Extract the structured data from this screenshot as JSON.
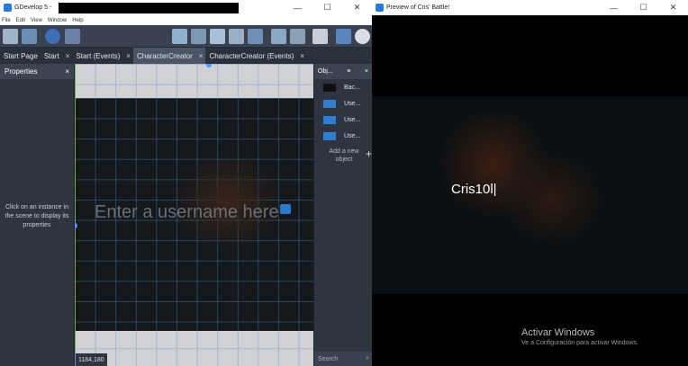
{
  "gdevelop": {
    "title": "GDevelop 5 -",
    "menu": [
      "File",
      "Edit",
      "View",
      "Window",
      "Help"
    ],
    "win_controls": {
      "minimize": "—",
      "maximize": "☐",
      "close": "✕"
    },
    "tabs": [
      {
        "label": "Start Page",
        "closable": false,
        "active": false
      },
      {
        "label": "Start",
        "closable": true,
        "active": false
      },
      {
        "label": "Start (Events)",
        "closable": true,
        "active": false
      },
      {
        "label": "CharacterCreator",
        "closable": true,
        "active": true
      },
      {
        "label": "CharacterCreator (Events)",
        "closable": true,
        "active": false
      }
    ],
    "tab_close": "×",
    "properties": {
      "title": "Properties",
      "close": "×",
      "message": "Click on an instance in the scene to display its properties"
    },
    "scene": {
      "placeholder_text": "Enter a username here",
      "coords": "1184,180"
    },
    "objects": {
      "title": "Obj...",
      "filter_icon": "≡",
      "close": "×",
      "items": [
        {
          "label": "Bac...",
          "thumb": "dark"
        },
        {
          "label": "Use...",
          "thumb": "blue"
        },
        {
          "label": "Use...",
          "thumb": "blue"
        },
        {
          "label": "Use...",
          "thumb": "blue"
        }
      ],
      "add_label": "Add a new object",
      "add_icon": "+",
      "search_placeholder": "Search",
      "search_icon": "⌕"
    },
    "colors": {
      "accent": "#4a5566",
      "panel": "#2e3440"
    }
  },
  "preview": {
    "title": "Preview of Cris' Battle!",
    "win_controls": {
      "minimize": "—",
      "maximize": "☐",
      "close": "✕"
    },
    "typed_text": "Cris10l|",
    "watermark_title": "Activar Windows",
    "watermark_sub": "Ve a Configuración para activar Windows."
  }
}
